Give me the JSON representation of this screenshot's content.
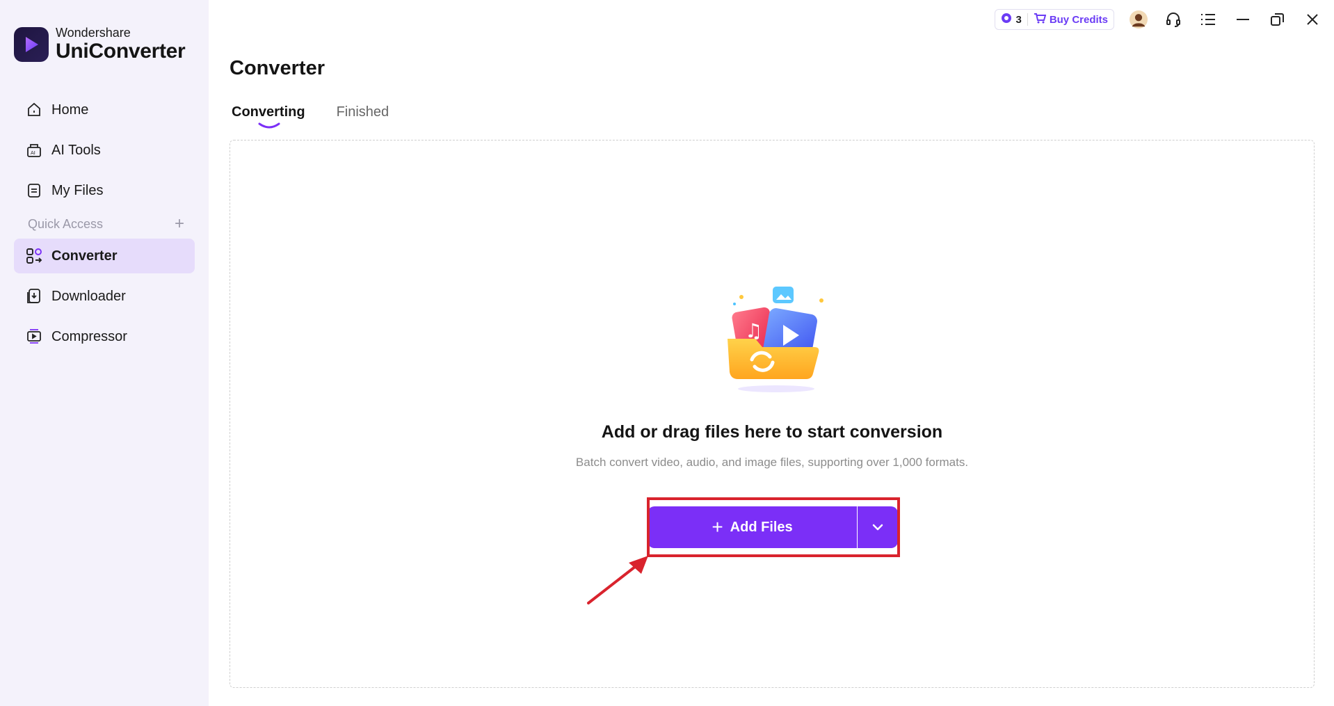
{
  "brand": {
    "sub": "Wondershare",
    "main": "UniConverter"
  },
  "sidebar": {
    "items": [
      {
        "label": "Home",
        "icon": "home-icon"
      },
      {
        "label": "AI Tools",
        "icon": "ai-tools-icon"
      },
      {
        "label": "My Files",
        "icon": "files-icon"
      }
    ],
    "quick_access_label": "Quick Access",
    "quick_items": [
      {
        "label": "Converter",
        "icon": "converter-icon",
        "active": true
      },
      {
        "label": "Downloader",
        "icon": "downloader-icon"
      },
      {
        "label": "Compressor",
        "icon": "compressor-icon"
      }
    ]
  },
  "topbar": {
    "credits_count": "3",
    "buy_credits_label": "Buy Credits",
    "icons": [
      "avatar",
      "headset-icon",
      "menu-list-icon",
      "minimize-icon",
      "restore-icon",
      "close-icon"
    ]
  },
  "page": {
    "title": "Converter"
  },
  "tabs": [
    {
      "label": "Converting",
      "active": true
    },
    {
      "label": "Finished",
      "active": false
    }
  ],
  "dropzone": {
    "title": "Add or drag files here to start conversion",
    "subtitle": "Batch convert video, audio, and image files, supporting over 1,000 formats.",
    "add_button_label": "Add Files"
  },
  "colors": {
    "accent": "#7b2ff7",
    "sidebar_bg": "#f4f2fb",
    "active_item_bg": "#e6dcfb",
    "highlight": "#d9232d"
  }
}
